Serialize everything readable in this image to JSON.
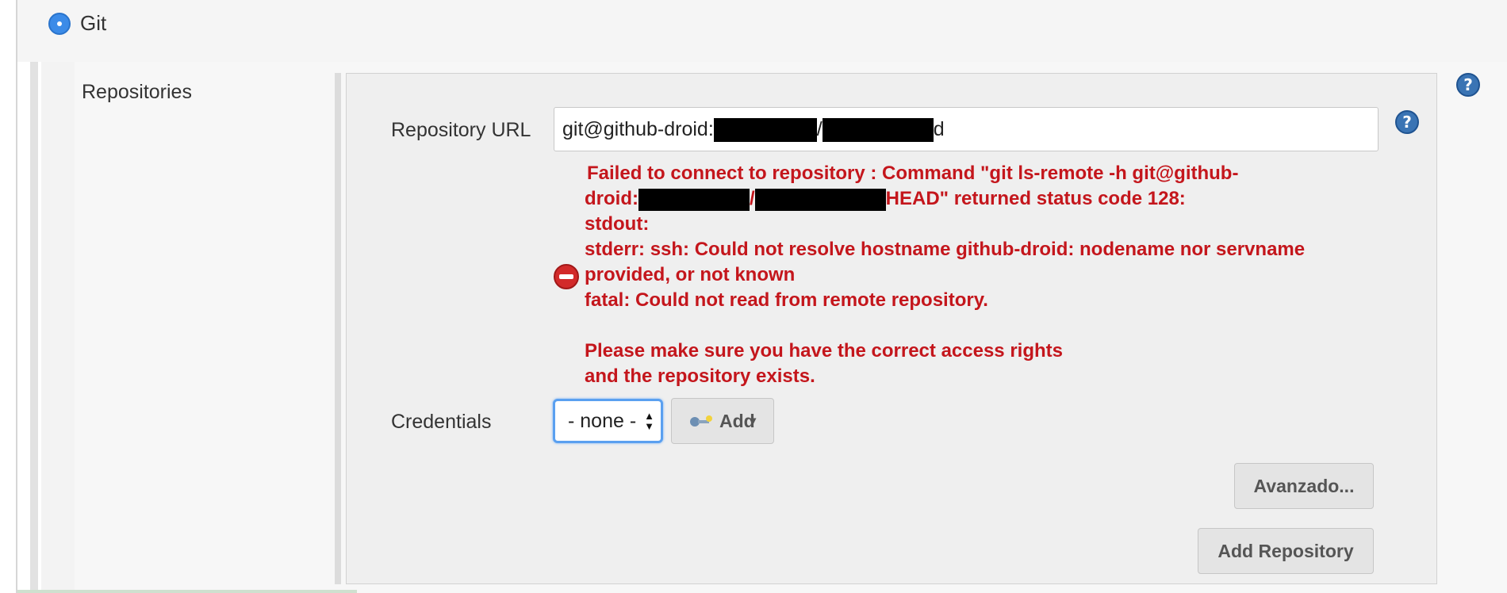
{
  "scm": {
    "option_label": "Git"
  },
  "repositories": {
    "section_label": "Repositories",
    "url": {
      "label": "Repository URL",
      "value_prefix": "git@github-droid:",
      "value_mid": "/",
      "value_suffix": "d"
    },
    "error": {
      "line1": "Failed to connect to repository : Command \"git ls-remote -h git@github-",
      "line2_prefix": "droid:",
      "line2_sep": "/",
      "line2_suffix": "HEAD\" returned status code 128:",
      "line3": "stdout:",
      "line4": "stderr: ssh: Could not resolve hostname github-droid: nodename nor servname",
      "line5": "provided, or not known",
      "line6": "fatal: Could not read from remote repository.",
      "line7": "Please make sure you have the correct access rights",
      "line8": "and the repository exists."
    },
    "credentials": {
      "label": "Credentials",
      "selected": "- none -",
      "add_label": "Add"
    },
    "advanced_label": "Avanzado...",
    "add_repository_label": "Add Repository"
  },
  "colors": {
    "error": "#c4161c",
    "radio_selected": "#3b8be8",
    "help": "#3a74b4"
  }
}
